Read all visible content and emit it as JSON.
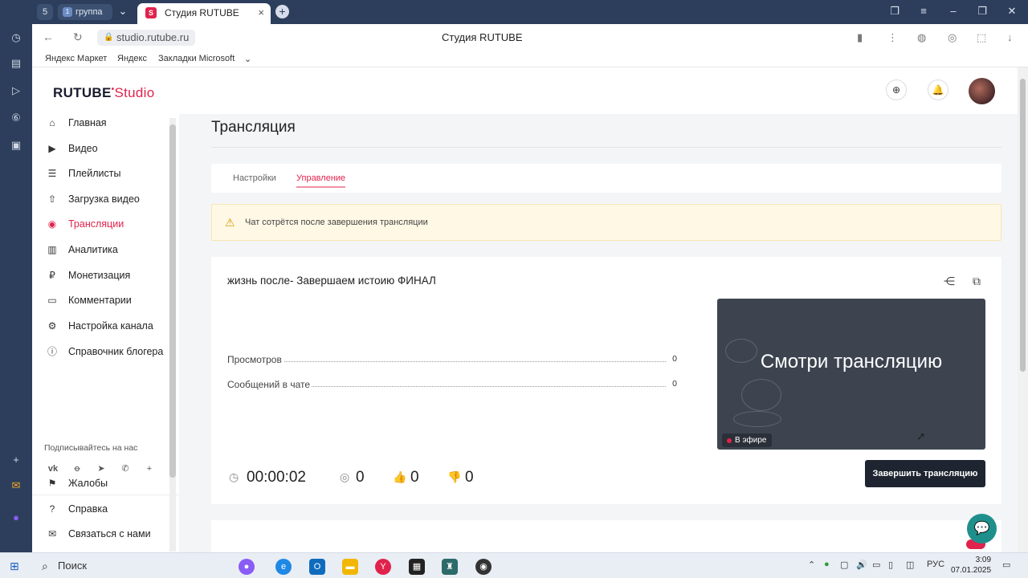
{
  "browser": {
    "tabs": [
      {
        "label": "5"
      },
      {
        "label": "группа 1"
      }
    ],
    "active_tab": {
      "title": "Студия RUTUBE",
      "favicon": "rutube-icon"
    },
    "url": "studio.rutube.ru",
    "page_title": "Студия RUTUBE",
    "bookmarks": [
      "Яндекс Маркет",
      "Яндекс",
      "Закладки Microsoft"
    ]
  },
  "header": {
    "logo_main": "RUTUBE",
    "logo_sub": "Studio",
    "icons": [
      "add-icon",
      "bell-icon",
      "avatar"
    ]
  },
  "sidebar": {
    "items": [
      {
        "label": "Главная",
        "icon": "home-icon"
      },
      {
        "label": "Видео",
        "icon": "video-icon"
      },
      {
        "label": "Плейлисты",
        "icon": "playlist-icon"
      },
      {
        "label": "Загрузка видео",
        "icon": "upload-icon"
      },
      {
        "label": "Трансляции",
        "icon": "broadcast-icon",
        "active": true
      },
      {
        "label": "Аналитика",
        "icon": "analytics-icon"
      },
      {
        "label": "Монетизация",
        "icon": "ruble-icon"
      },
      {
        "label": "Комментарии",
        "icon": "comment-icon"
      },
      {
        "label": "Настройка канала",
        "icon": "gear-icon"
      },
      {
        "label": "Справочник блогера",
        "icon": "info-icon"
      }
    ],
    "subscribe_caption": "Подписывайтесь на нас",
    "socials": [
      "vk-icon",
      "ok-icon",
      "telegram-icon",
      "viber-icon",
      "plus-icon"
    ],
    "bottom_items": [
      {
        "label": "Жалобы",
        "icon": "flag-icon"
      },
      {
        "label": "Справка",
        "icon": "help-icon"
      },
      {
        "label": "Связаться с нами",
        "icon": "mail-icon"
      }
    ]
  },
  "main": {
    "title": "Трансляция",
    "tabs": [
      {
        "label": "Настройки"
      },
      {
        "label": "Управление",
        "active": true
      }
    ],
    "warning": "Чат сотрётся после завершения трансляции",
    "stream": {
      "title": "жизнь после- Завершаем истоию ФИНАЛ",
      "stats": [
        {
          "label": "Просмотров",
          "value": "0"
        },
        {
          "label": "Сообщений в чате",
          "value": "0"
        }
      ],
      "preview_text": "Смотри трансляцию",
      "live_badge": "В эфире",
      "timer": "00:00:02",
      "viewers": "0",
      "likes": "0",
      "dislikes": "0",
      "end_button": "Завершить трансляцию"
    }
  },
  "taskbar": {
    "search": "Поиск",
    "lang": "РУС",
    "time": "3:09",
    "date": "07.01.2025"
  },
  "colors": {
    "accent": "#e0234c",
    "dark_button": "#1f2530",
    "warning_bg": "#fff8e5",
    "browser_chrome": "#2c3e5c"
  }
}
